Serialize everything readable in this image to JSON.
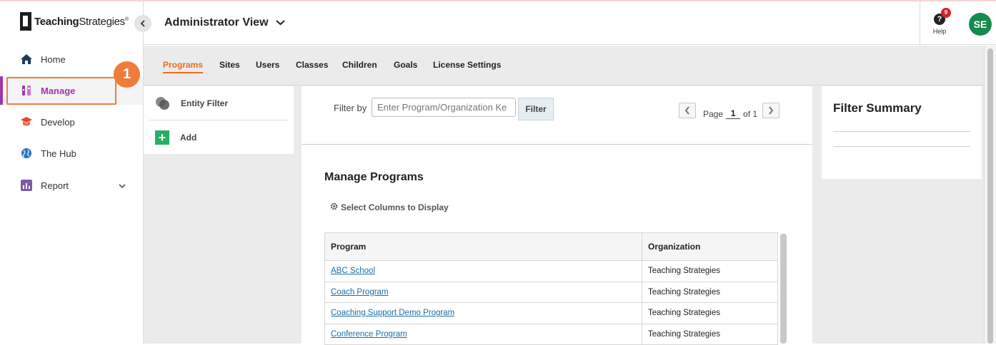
{
  "brand": {
    "name_bold": "Teaching",
    "name_regular": "Strategies",
    "trademark": "®"
  },
  "sidebar": {
    "items": [
      {
        "label": "Home",
        "icon": "home-icon"
      },
      {
        "label": "Manage",
        "icon": "manage-icon"
      },
      {
        "label": "Develop",
        "icon": "graduation-cap-icon"
      },
      {
        "label": "The Hub",
        "icon": "globe-icon"
      },
      {
        "label": "Report",
        "icon": "bar-chart-icon"
      }
    ],
    "callout_number": "1"
  },
  "header": {
    "view_title": "Administrator View",
    "help_label": "Help",
    "help_badge_count": "9",
    "avatar_initials": "SE"
  },
  "tabs": [
    "Programs",
    "Sites",
    "Users",
    "Classes",
    "Children",
    "Goals",
    "License Settings"
  ],
  "left_panel": {
    "entity_filter": "Entity Filter",
    "add": "Add"
  },
  "filter": {
    "label": "Filter by",
    "placeholder": "Enter Program/Organization Ke",
    "button": "Filter"
  },
  "pagination": {
    "page_label": "Page",
    "current": "1",
    "of_label": "of 1"
  },
  "manage": {
    "title": "Manage Programs",
    "select_columns": "Select Columns to Display",
    "columns": [
      "Program",
      "Organization"
    ],
    "rows": [
      {
        "program": "ABC School",
        "organization": "Teaching Strategies"
      },
      {
        "program": "Coach Program",
        "organization": "Teaching Strategies"
      },
      {
        "program": "Coaching Support Demo Program",
        "organization": "Teaching Strategies"
      },
      {
        "program": "Conference Program",
        "organization": "Teaching Strategies"
      }
    ]
  },
  "summary": {
    "title": "Filter Summary"
  },
  "colors": {
    "manage_accent": "#9e38a8",
    "tab_accent": "#f06a1e",
    "callout": "#f07c3a",
    "avatar": "#178a4f",
    "add_green": "#23b062"
  }
}
